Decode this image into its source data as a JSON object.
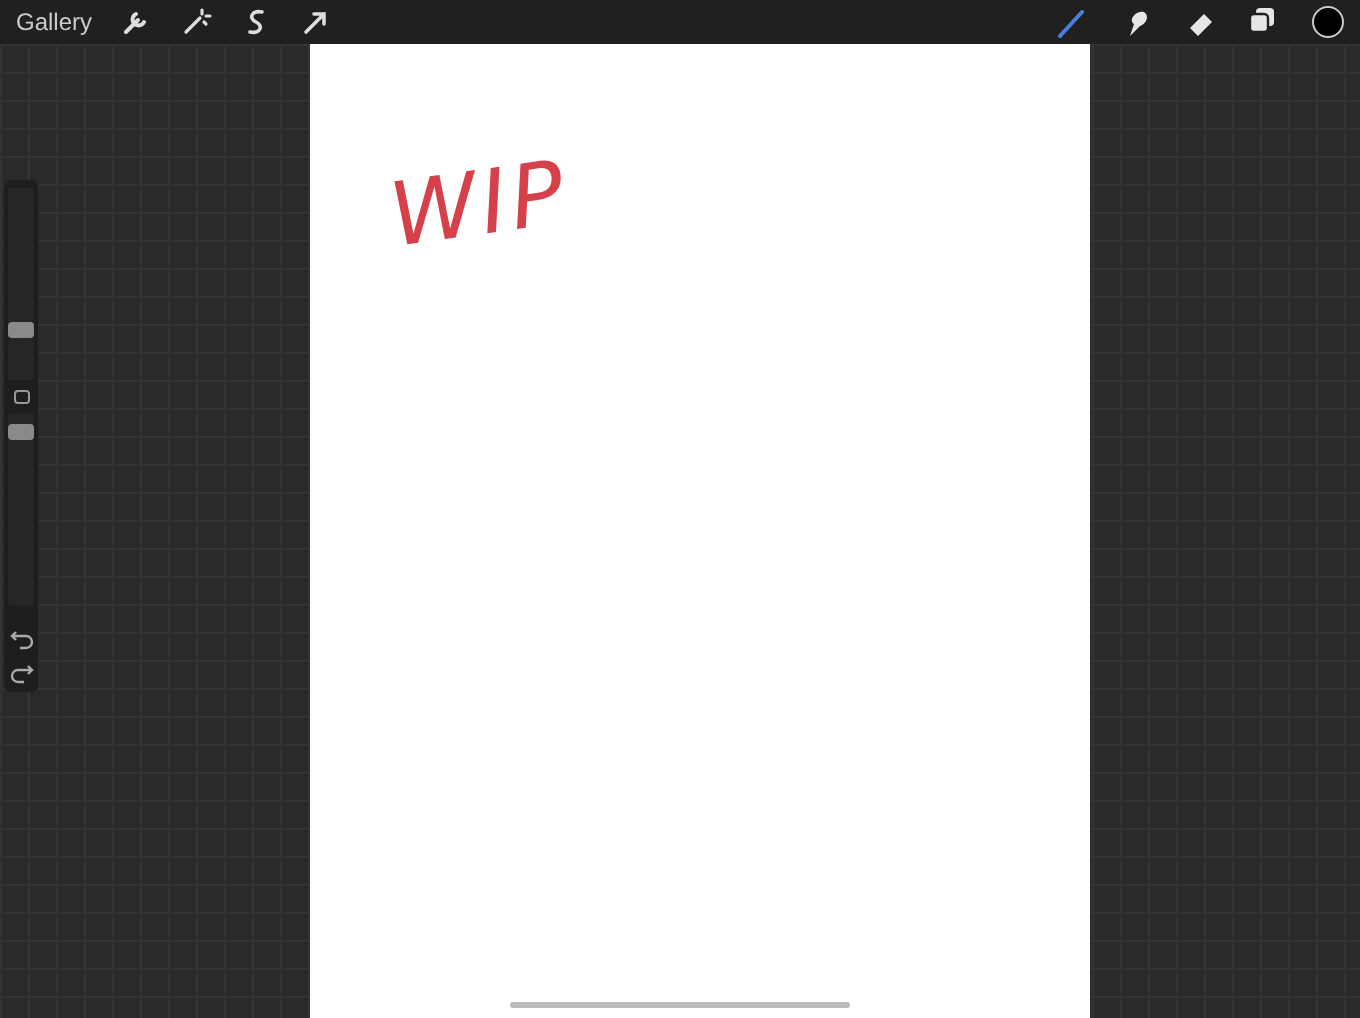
{
  "top_bar": {
    "gallery": "Gallery",
    "actions": [
      {
        "kind": "wrench"
      },
      {
        "kind": "wand"
      },
      {
        "kind": "selection"
      },
      {
        "kind": "transform"
      }
    ],
    "paint_tools": [
      {
        "kind": "brush",
        "selected": true
      },
      {
        "kind": "smudge",
        "selected": false
      },
      {
        "kind": "eraser",
        "selected": false
      }
    ]
  },
  "sidebar": {
    "brush_size": {
      "level": 0.22
    },
    "opacity": {
      "level": 0.9
    }
  },
  "canvas": {
    "annotation": "WIP"
  }
}
